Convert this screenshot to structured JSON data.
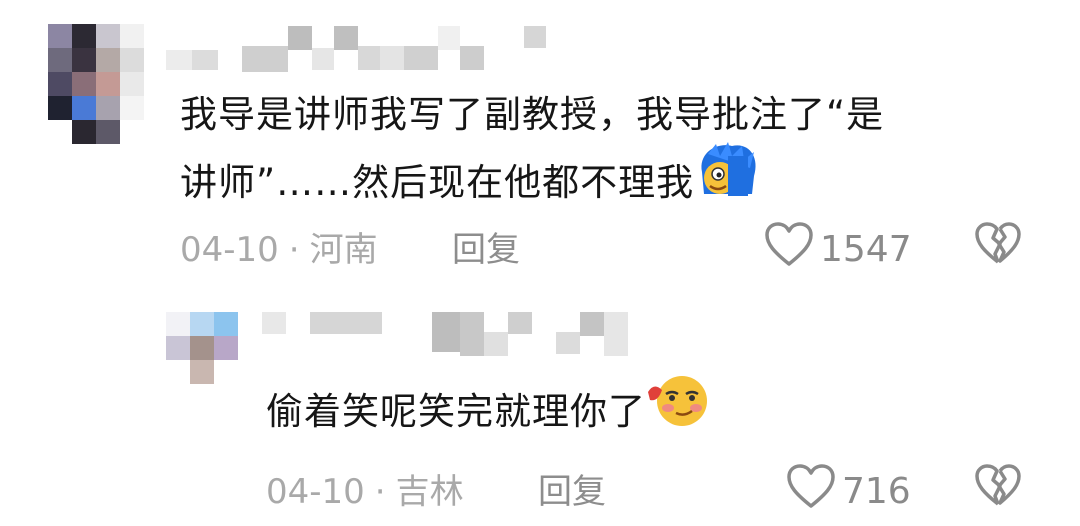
{
  "comments": [
    {
      "text_line1": "我导是讲师我写了副教授，我导批注了“是",
      "text_line2": "讲师”……然后现在他都不理我",
      "date": "04-10",
      "separator": "·",
      "location": "河南",
      "reply_label": "回复",
      "like_count": "1547",
      "emoji": "blue-hair-face-emoji"
    },
    {
      "text": "偷着笑呢笑完就理你了",
      "date": "04-10",
      "separator": "·",
      "location": "吉林",
      "reply_label": "回复",
      "like_count": "716",
      "emoji": "smirk-blush-face-emoji"
    }
  ],
  "icons": {
    "like": "heart-outline-icon",
    "dislike": "broken-heart-icon"
  },
  "colors": {
    "text": "#161616",
    "meta": "#a9a9a9",
    "reply": "#8d8d8d",
    "icon": "#8a8a8a"
  }
}
